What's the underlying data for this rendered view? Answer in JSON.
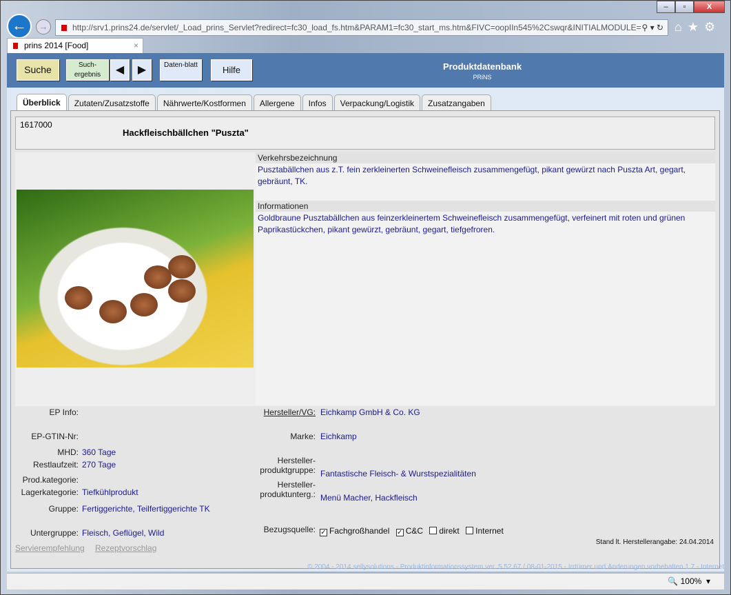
{
  "browser": {
    "url": "http://srv1.prins24.de/servlet/_Load_prins_Servlet?redirect=fc30_load_fs.htm&PARAM1=fc30_start_ms.htm&FIVC=oopIIn545%2Cswqr&INITIALMODULE=",
    "tab_title": "prins 2014 [Food]",
    "zoom": "100%"
  },
  "header": {
    "suche": "Suche",
    "suchergebnis": "Such-ergebnis",
    "datenblatt": "Daten-blatt",
    "hilfe": "Hilfe",
    "title": "Produktdatenbank",
    "subtitle": "PRiNS"
  },
  "tabs": [
    {
      "label": "Überblick"
    },
    {
      "label": "Zutaten/Zusatzstoffe"
    },
    {
      "label": "Nährwerte/Kostformen"
    },
    {
      "label": "Allergene"
    },
    {
      "label": "Infos"
    },
    {
      "label": "Verpackung/Logistik"
    },
    {
      "label": "Zusatzangaben"
    }
  ],
  "product": {
    "id": "1617000",
    "name": "Hackfleischbällchen \"Puszta\""
  },
  "sections": [
    {
      "title": "Verkehrsbezeichnung",
      "text": "Pusztabällchen aus z.T. fein zerkleinerten Schweinefleisch zusammengefügt, pikant gewürzt nach Puszta Art, gegart, gebräunt, TK."
    },
    {
      "title": "Informationen",
      "text": "Goldbraune Pusztabällchen aus feinzerkleinertem Schweinefleisch zusammengefügt, verfeinert mit roten und grünen Paprikastückchen, pikant gewürzt, gebräunt, gegart, tiefgefroren."
    }
  ],
  "left_fields": {
    "ep_info": "EP Info:",
    "ep_gtin": "EP-GTIN-Nr:",
    "mhd": "MHD:",
    "mhd_val": "360 Tage",
    "rest": "Restlaufzeit:",
    "rest_val": "270 Tage",
    "prodkat": "Prod.kategorie:",
    "lager": "Lagerkategorie:",
    "lager_val": "Tiefkühlprodukt",
    "gruppe": "Gruppe:",
    "gruppe_val": "Fertiggerichte, Teilfertiggerichte TK",
    "untergruppe": "Untergruppe:",
    "untergruppe_val": "Fleisch, Geflügel, Wild"
  },
  "right_fields": {
    "hersteller": "Hersteller/VG:",
    "hersteller_val": "Eichkamp GmbH & Co. KG",
    "marke": "Marke:",
    "marke_val": "Eichkamp",
    "hpg1": "Hersteller-",
    "hpg2": "produktgruppe:",
    "hpg_val": "Fantastische Fleisch- & Wurstspezialitäten",
    "hpu1": "Hersteller-",
    "hpu2": "produktunterg.:",
    "hpu_val": "Menü Macher, Hackfleisch",
    "bezug": "Bezugsquelle:"
  },
  "bezugsquellen": [
    {
      "label": "Fachgroßhandel",
      "checked": true
    },
    {
      "label": "C&C",
      "checked": true
    },
    {
      "label": "direkt",
      "checked": false
    },
    {
      "label": "Internet",
      "checked": false
    }
  ],
  "links": {
    "servier": "Servierempfehlung",
    "rezept": "Rezeptvorschlag"
  },
  "stand": "Stand lt. Herstellerangabe: 24.04.2014",
  "footer": "© 2004 - 2014 sellysolutions - Produktinformationssystem ver. 5.52.67 / 08-01-2015 - Irrtümer und Änderungen vorbehalten  1.7 - Internet"
}
